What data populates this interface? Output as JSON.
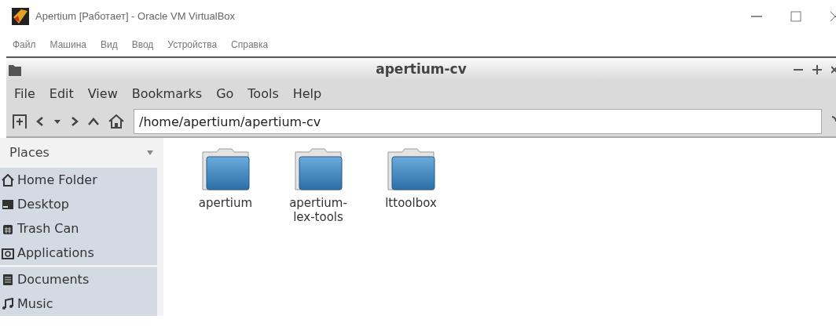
{
  "window": {
    "title": "Apertium [Работает] - Oracle VM VirtualBox"
  },
  "host_menu": [
    "Файл",
    "Машина",
    "Вид",
    "Ввод",
    "Устройства",
    "Справка"
  ],
  "file_manager": {
    "title": "apertium-cv",
    "menu": [
      "File",
      "Edit",
      "View",
      "Bookmarks",
      "Go",
      "Tools",
      "Help"
    ],
    "location": "/home/apertium/apertium-cv",
    "sidebar": {
      "header": "Places",
      "sections": [
        {
          "items": [
            {
              "label": "Home Folder",
              "kind": "home"
            },
            {
              "label": "Desktop",
              "kind": "desktop"
            },
            {
              "label": "Trash Can",
              "kind": "trash"
            },
            {
              "label": "Applications",
              "kind": "applications"
            }
          ]
        },
        {
          "items": [
            {
              "label": "Documents",
              "kind": "documents"
            },
            {
              "label": "Music",
              "kind": "music"
            }
          ]
        }
      ]
    },
    "folders": [
      {
        "name": "apertium"
      },
      {
        "name": "apertium-\nlex-tools"
      },
      {
        "name": "lttoolbox"
      }
    ]
  }
}
